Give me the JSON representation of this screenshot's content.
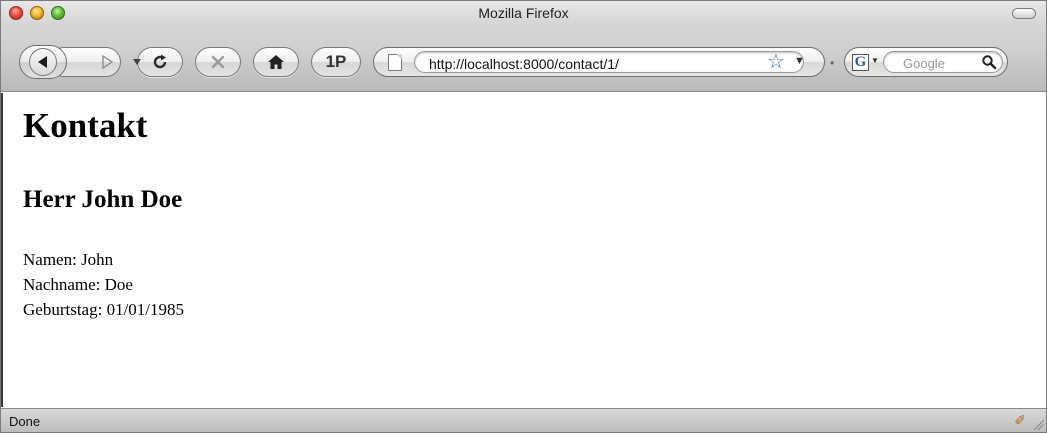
{
  "window": {
    "title": "Mozilla Firefox"
  },
  "toolbar": {
    "one_p_label": "1P",
    "url": "http://localhost:8000/contact/1/",
    "search_placeholder": "Google",
    "search_engine_letter": "G",
    "icons": [
      "back-icon",
      "forward-icon",
      "history-dropdown-icon",
      "reload-icon",
      "stop-icon",
      "home-icon",
      "page-icon",
      "bookmark-star-icon",
      "search-icon"
    ]
  },
  "content": {
    "heading": "Kontakt",
    "subheading": "Herr John Doe",
    "details": [
      "Namen: John",
      "Nachname: Doe",
      "Geburtstag: 01/01/1985"
    ]
  },
  "status": {
    "text": "Done"
  },
  "colors": {
    "close": "#f2473c",
    "minimize": "#f5b52a",
    "zoom": "#5fc235",
    "star": "#3b6fd4",
    "google_g": "#2a56c6"
  }
}
